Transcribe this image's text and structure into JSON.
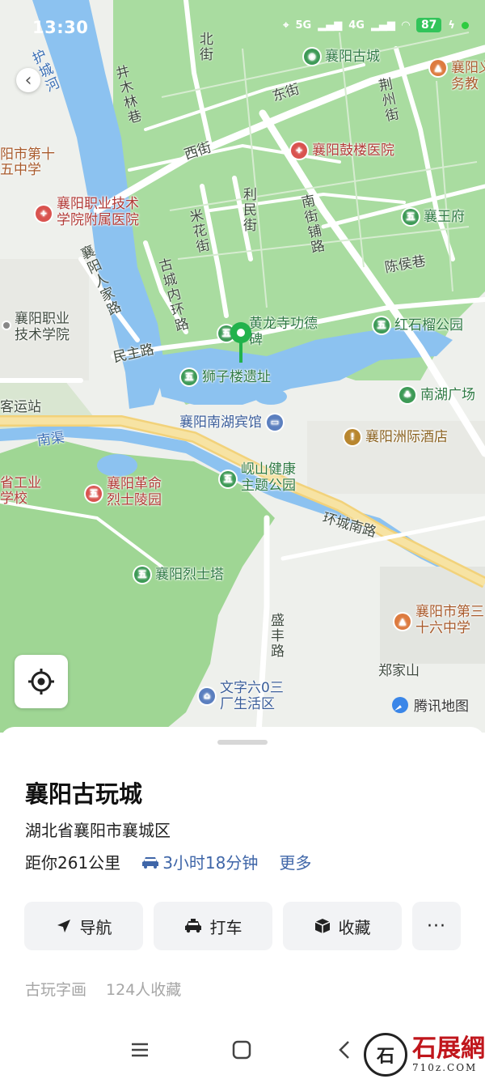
{
  "status_bar": {
    "time": "13:30",
    "network_5g": "5G",
    "network_4g": "4G",
    "battery": "87"
  },
  "map": {
    "street_labels": {
      "hucheng_river": "护城河",
      "bei_jie": "北街",
      "jingmu_lin_xiang": "井木林巷",
      "dong_jie": "东街",
      "jingzhou_jie": "荆州街",
      "xi_jie": "西街",
      "limin_jie": "利民街",
      "nanjie_puluo": "南街铺路",
      "mihua_jie": "米花街",
      "gucheng_neihuan_lu": "古城内环路",
      "xiangyang_renjia_lu": "襄阳人家路",
      "chenhou_xiang": "陈侯巷",
      "minzhu_lu": "民主路",
      "nanqu": "南渠",
      "huancheng_nan_lu": "环城南路",
      "sheng_lu": "盛丰路",
      "zhengjia_shan": "郑家山",
      "keyunzhan": "客运站",
      "gongye_xuexiao": "省工业学校",
      "no15_school": "阳市第十五中学"
    },
    "pois": [
      {
        "name": "襄阳古城",
        "icon": "camera-icon",
        "color": "#3d9a56"
      },
      {
        "name": "襄阳义务教",
        "icon": "school-icon",
        "color": "#dd7b3f"
      },
      {
        "name": "襄阳鼓楼医院",
        "icon": "hospital-icon",
        "color": "#d9534f"
      },
      {
        "name": "襄阳职业技术学院附属医院",
        "icon": "hospital-icon",
        "color": "#d9534f"
      },
      {
        "name": "襄王府",
        "icon": "scenic-icon",
        "color": "#3d9a56"
      },
      {
        "name": "襄阳职业技术学院",
        "icon": "dot-icon",
        "color": "#888888"
      },
      {
        "name": "黄龙寺功德碑",
        "icon": "scenic-icon",
        "color": "#3d9a56"
      },
      {
        "name": "红石榴公园",
        "icon": "scenic-icon",
        "color": "#3d9a56"
      },
      {
        "name": "狮子楼遗址",
        "icon": "scenic-icon",
        "color": "#3d9a56"
      },
      {
        "name": "南湖广场",
        "icon": "park-icon",
        "color": "#3d9a56"
      },
      {
        "name": "襄阳南湖宾馆",
        "icon": "hotel-icon",
        "color": "#5b7fbf"
      },
      {
        "name": "襄阳洲际酒店",
        "icon": "hotel-icon",
        "color": "#b8862e"
      },
      {
        "name": "岘山健康主题公园",
        "icon": "scenic-icon",
        "color": "#3d9a56"
      },
      {
        "name": "襄阳革命烈士陵园",
        "icon": "scenic-icon",
        "color": "#d9534f"
      },
      {
        "name": "襄阳烈士塔",
        "icon": "scenic-icon",
        "color": "#3d9a56"
      },
      {
        "name": "襄阳市第三十六中学",
        "icon": "school-icon",
        "color": "#dd7b3f"
      },
      {
        "name": "文字六0三厂生活区",
        "icon": "residence-icon",
        "color": "#5b7fbf"
      }
    ],
    "attribution": "腾讯地图"
  },
  "place": {
    "title": "襄阳古玩城",
    "address": "湖北省襄阳市襄城区",
    "distance": "距你261公里",
    "drive_time": "3小时18分钟",
    "more": "更多",
    "tags": [
      "古玩字画",
      "124人收藏"
    ]
  },
  "actions": {
    "navigate": "导航",
    "taxi": "打车",
    "favorite": "收藏",
    "more": "···"
  },
  "watermark": {
    "name": "石展網",
    "url": "710z.COM",
    "seal": "石"
  }
}
